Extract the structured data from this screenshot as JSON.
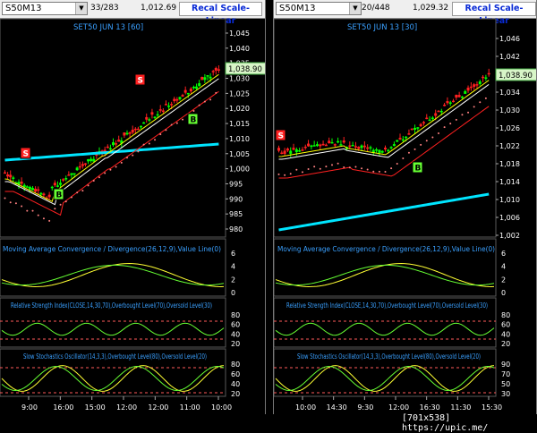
{
  "panels": [
    {
      "symbol": "S50M13",
      "count": "33/283",
      "price": "1,012.69",
      "recal_label": "Recal Scale-Linear",
      "title": "SET50 JUN 13   [60]",
      "last_price": "1,038.90",
      "price_axis": [
        "1,045",
        "1,040",
        "1,035",
        "1,030",
        "1,025",
        "1,020",
        "1,015",
        "1,010",
        "1,005",
        "1,000",
        "995",
        "990",
        "985",
        "980"
      ],
      "signals": [
        {
          "text": "S"
        },
        {
          "text": "S"
        },
        {
          "text": "B"
        },
        {
          "text": "B"
        }
      ],
      "macd_title": "Moving Average Convergence / Divergence(26,12,9),Value Line(0)",
      "macd_axis": [
        "6",
        "4",
        "2",
        "0"
      ],
      "rsi_title": "Relative Strength Index(CLOSE,14,30,70),Overbought Level(70),Oversold Level(30)",
      "rsi_axis": [
        "80",
        "60",
        "40",
        "20"
      ],
      "sto_title": "Slow Stochastics Oscillator(14,3,3),Overbought Level(80),Oversold Level(20)",
      "sto_axis": [
        "80",
        "60",
        "40",
        "20"
      ],
      "time_axis": [
        "9:00",
        "16:00",
        "15:00",
        "12:00",
        "12:00",
        "11:00",
        "10:00"
      ]
    },
    {
      "symbol": "S50M13",
      "count": "20/448",
      "price": "1,029.32",
      "recal_label": "Recal Scale-Linear",
      "title": "SET50 JUN 13   [30]",
      "last_price": "1,038.90",
      "price_axis": [
        "1,046",
        "1,042",
        "1,038",
        "1,034",
        "1,030",
        "1,026",
        "1,022",
        "1,018",
        "1,014",
        "1,010",
        "1,006",
        "1,002"
      ],
      "signals": [
        {
          "text": "S"
        },
        {
          "text": "B"
        }
      ],
      "macd_title": "Moving Average Convergence / Divergence(26,12,9),Value Line(0)",
      "macd_axis": [
        "6",
        "4",
        "2",
        "0"
      ],
      "rsi_title": "Relative Strength Index(CLOSE,14,30,70),Overbought Level(70),Oversold Level(30)",
      "rsi_axis": [
        "80",
        "60",
        "40",
        "20"
      ],
      "sto_title": "Slow Stochastics Oscillator(14,3,3),Overbought Level(80),Oversold Level(20)",
      "sto_axis": [
        "90",
        "70",
        "50",
        "30"
      ],
      "time_axis": [
        "10:00",
        "14:30",
        "9:30",
        "12:00",
        "16:30",
        "11:30",
        "15:30"
      ]
    }
  ],
  "watermark": "[701x538] https://upic.me/",
  "colors": {
    "up": "#00ff00",
    "down": "#ff2020",
    "ma_long": "#00e5ff",
    "ma_mid": "#ffffff",
    "ma_short": "#ffff00",
    "ma_red": "#ff2020",
    "sar": "#ff8080",
    "signal_s": "#ff2020",
    "signal_b": "#66ff33"
  }
}
